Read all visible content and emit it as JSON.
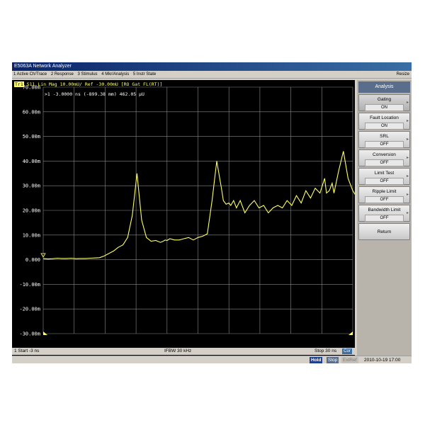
{
  "window": {
    "title": "E5063A Network Analyzer",
    "resize_label": "Resize"
  },
  "menu": {
    "items": [
      {
        "label": "1 Active Ch/Trace"
      },
      {
        "label": "2 Response"
      },
      {
        "label": "3 Stimulus"
      },
      {
        "label": "4 Mkr/Analysis"
      },
      {
        "label": "5 Instr State"
      }
    ]
  },
  "trace": {
    "tag": "Tr1",
    "description": "S11 Lin Mag 10.00mU/ Ref -30.00mU [RO Gat FL(RT)]",
    "color": "#ffff66"
  },
  "marker": {
    "readout": ">1 -3.0000 ns (-899.38 mm)  462.05 µU"
  },
  "chart_data": {
    "type": "line",
    "title": "",
    "xlabel": "",
    "ylabel": "",
    "y_ticks": [
      "70.00m",
      "60.00m",
      "50.00m",
      "40.00m",
      "30.00m",
      "20.00m",
      "10.00m",
      "0.000",
      "-10.00m",
      "-20.00m",
      "-30.00m"
    ],
    "ylim": [
      -0.03,
      0.07
    ],
    "xlim": [
      -3,
      30
    ],
    "x_units": "ns",
    "grid": true,
    "series": [
      {
        "color": "#ffff66",
        "x": [
          -3,
          -2.5,
          -2,
          -1.5,
          -1,
          -0.5,
          0,
          0.5,
          1,
          1.5,
          2,
          2.5,
          3,
          3.5,
          4,
          4.5,
          5,
          5.5,
          6,
          6.5,
          7,
          7.5,
          8,
          8.5,
          9,
          9.5,
          9.8,
          10,
          10.2,
          10.5,
          11,
          11.5,
          12,
          12.5,
          13,
          13.5,
          14,
          14.5,
          15,
          15.5,
          16,
          16.2,
          16.5,
          16.8,
          17,
          17.3,
          17.6,
          18,
          18.5,
          19,
          19.5,
          20,
          20.5,
          21,
          21.5,
          22,
          22.5,
          23,
          23.5,
          24,
          24.5,
          25,
          25.5,
          26,
          26.5,
          27,
          27.2,
          27.5,
          27.8,
          28,
          28.5,
          29,
          29.5,
          30,
          30.5,
          31,
          31.5,
          32,
          32.5,
          33
        ],
        "y": [
          0.0005,
          0.0003,
          0.0004,
          0.0006,
          0.0005,
          0.0005,
          0.0006,
          0.0004,
          0.0005,
          0.0005,
          0.0006,
          0.0007,
          0.0008,
          0.0015,
          0.0025,
          0.0035,
          0.005,
          0.006,
          0.009,
          0.018,
          0.035,
          0.016,
          0.009,
          0.0075,
          0.0078,
          0.007,
          0.0075,
          0.008,
          0.0078,
          0.0085,
          0.008,
          0.008,
          0.0085,
          0.009,
          0.008,
          0.009,
          0.0095,
          0.0105,
          0.024,
          0.04,
          0.029,
          0.024,
          0.0225,
          0.023,
          0.022,
          0.024,
          0.021,
          0.024,
          0.019,
          0.022,
          0.024,
          0.021,
          0.022,
          0.019,
          0.021,
          0.022,
          0.021,
          0.024,
          0.022,
          0.026,
          0.023,
          0.028,
          0.025,
          0.029,
          0.027,
          0.033,
          0.027,
          0.028,
          0.031,
          0.027,
          0.036,
          0.044,
          0.033,
          0.028,
          0.025,
          0.02,
          0.016,
          0.012,
          0.01,
          0.008
        ]
      }
    ]
  },
  "stimulus": {
    "start_label": "1  Start -3 ns",
    "ifbw_label": "IFBW 30 kHz",
    "stop_label": "Stop 30 ns",
    "cont_label": "Cor"
  },
  "softkeys": {
    "title": "Analysis",
    "items": [
      {
        "label": "Gating",
        "value": "ON"
      },
      {
        "label": "Fault Location",
        "value": "ON"
      },
      {
        "label": "SRL",
        "value": "OFF"
      },
      {
        "label": "Conversion",
        "value": "OFF"
      },
      {
        "label": "Limit Test",
        "value": "OFF"
      },
      {
        "label": "Ripple Limit",
        "value": "OFF"
      },
      {
        "label": "Bandwidth Limit",
        "value": "OFF"
      },
      {
        "label": "Return"
      }
    ]
  },
  "status": {
    "hold": "Hold",
    "stop": "Stop",
    "extref": "ExtRef",
    "datetime": "2010-10-19 17:00"
  },
  "colors": {
    "screen_bg": "#000000",
    "grid": "#8a8a8a",
    "trace": "#ffff66",
    "panel_accent": "#5a6e8c"
  }
}
